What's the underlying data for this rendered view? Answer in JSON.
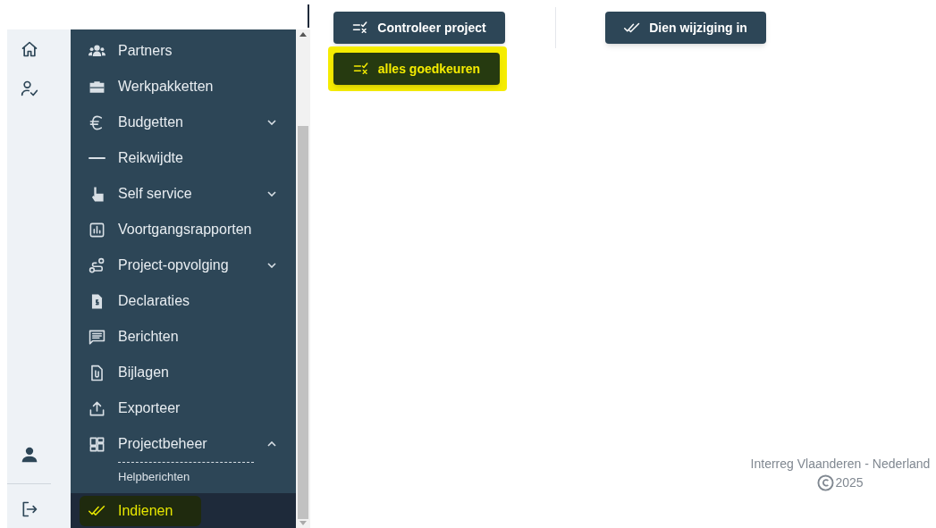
{
  "rail": {
    "items": [
      {
        "kind": "home"
      },
      {
        "kind": "user-check"
      }
    ],
    "bottom_items": [
      {
        "kind": "person"
      },
      {
        "kind": "logout"
      }
    ]
  },
  "sidebar": {
    "items": [
      {
        "kind": "users",
        "label": "Partners",
        "selected": false,
        "highlighted": false
      },
      {
        "kind": "briefcase",
        "label": "Werkpakketten",
        "selected": false,
        "highlighted": false
      },
      {
        "kind": "euro",
        "label": "Budgetten",
        "expanded": false,
        "selected": false,
        "highlighted": false
      },
      {
        "kind": "dash",
        "label": "Reikwijdte",
        "selected": false,
        "highlighted": false
      },
      {
        "kind": "hand",
        "label": "Self service",
        "expanded": false,
        "selected": false,
        "highlighted": false
      },
      {
        "kind": "chart",
        "label": "Voortgangsrapporten",
        "selected": false,
        "highlighted": false
      },
      {
        "kind": "route",
        "label": "Project-opvolging",
        "expanded": false,
        "selected": false,
        "highlighted": false
      },
      {
        "kind": "invoice",
        "label": "Declaraties",
        "selected": false,
        "highlighted": false
      },
      {
        "kind": "message",
        "label": "Berichten",
        "selected": false,
        "highlighted": false
      },
      {
        "kind": "attachment",
        "label": "Bijlagen",
        "selected": false,
        "highlighted": false
      },
      {
        "kind": "upload",
        "label": "Exporteer",
        "selected": false,
        "highlighted": false
      },
      {
        "kind": "grid",
        "label": "Projectbeheer",
        "expanded": true,
        "selected": false,
        "highlighted": false,
        "children": [
          {
            "label": "Helpberichten"
          }
        ]
      },
      {
        "kind": "double-check",
        "label": "Indienen",
        "selected": true,
        "highlighted": true
      }
    ]
  },
  "buttons": [
    {
      "kind": "checklist",
      "label": "Controleer project",
      "highlighted": false
    },
    {
      "kind": "double-check",
      "label": "Dien wijziging in",
      "highlighted": false
    },
    {
      "kind": "checklist",
      "label": "alles goedkeuren",
      "highlighted": true
    }
  ],
  "footer": {
    "organisation": "Interreg Vlaanderen - Nederland",
    "year": "2025"
  }
}
